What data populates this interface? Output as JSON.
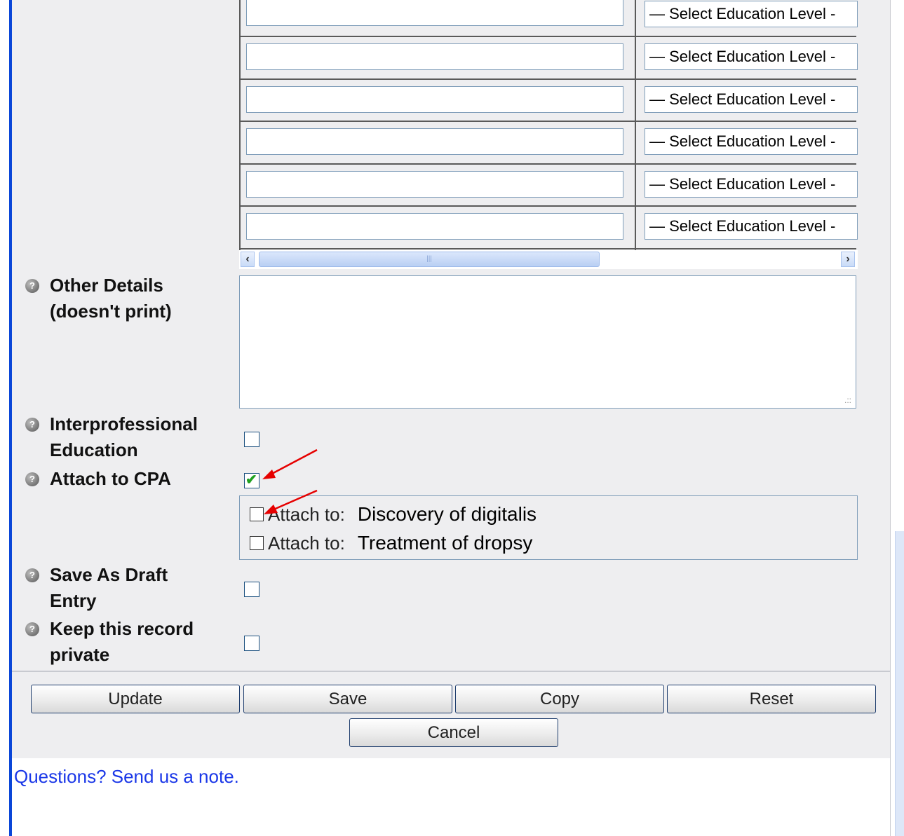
{
  "education_levels": {
    "select_placeholder": "— Select Education Level -",
    "rows": [
      {
        "value": "",
        "level": "— Select Education Level -"
      },
      {
        "value": "",
        "level": "— Select Education Level -"
      },
      {
        "value": "",
        "level": "— Select Education Level -"
      },
      {
        "value": "",
        "level": "— Select Education Level -"
      },
      {
        "value": "",
        "level": "— Select Education Level -"
      },
      {
        "value": "",
        "level": "— Select Education Level -"
      }
    ]
  },
  "other_details": {
    "label_line1": "Other Details",
    "label_line2": "(doesn't print)",
    "value": ""
  },
  "interprofessional": {
    "label_line1": "Interprofessional",
    "label_line2": "Education",
    "checked": false
  },
  "attach_cpa": {
    "label": "Attach to CPA",
    "checked": true,
    "targets": [
      {
        "prefix": "Attach to:",
        "name": "Discovery of digitalis",
        "checked": false
      },
      {
        "prefix": "Attach to:",
        "name": "Treatment of dropsy",
        "checked": false
      }
    ]
  },
  "draft": {
    "label_line1": "Save As Draft",
    "label_line2": "Entry",
    "checked": false
  },
  "private": {
    "label_line1": "Keep this record",
    "label_line2": "private",
    "checked": false
  },
  "buttons": {
    "update": "Update",
    "save": "Save",
    "copy": "Copy",
    "reset": "Reset",
    "cancel": "Cancel"
  },
  "footer": {
    "link_text": "Questions? Send us a note."
  },
  "colors": {
    "link": "#1a37e8",
    "annotation_arrow": "#e60000",
    "check_green": "#21a121"
  }
}
